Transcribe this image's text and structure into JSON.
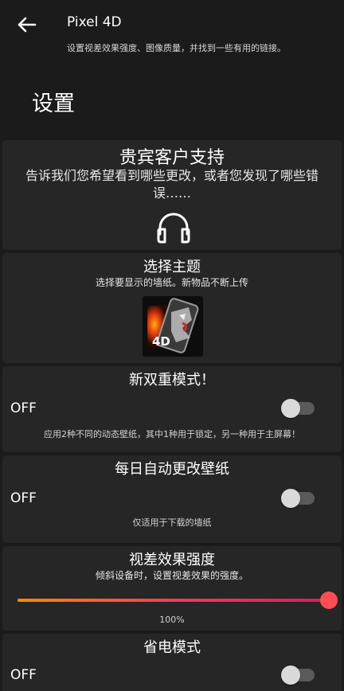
{
  "header": {
    "back_icon": "arrow-left-icon",
    "app_title": "Pixel 4D",
    "subtitle": "设置视差效果强度、图像质量，并找到一些有用的链接。"
  },
  "page_title": "设置",
  "cards": {
    "vip_support": {
      "title": "贵宾客户支持",
      "description": "告诉我们您希望看到哪些更改，或者您发现了哪些错误……",
      "icon": "headset-icon"
    },
    "theme": {
      "title": "选择主题",
      "description": "选择要显示的墙纸。新物品不断上传",
      "thumbnail_label": "4D"
    },
    "dual_mode": {
      "title": "新双重模式！",
      "state_label": "OFF",
      "enabled": false,
      "note": "应用2种不同的动态壁纸，其中1种用于锁定，另一种用于主屏幕！"
    },
    "daily_change": {
      "title": "每日自动更改壁纸",
      "state_label": "OFF",
      "enabled": false,
      "note": "仅适用于下载的墙纸"
    },
    "parallax": {
      "title": "视差效果强度",
      "description": "倾斜设备时，设置视差效果的强度。",
      "value": 1.0,
      "value_label": "100%"
    },
    "power_saving": {
      "title": "省电模式",
      "state_label": "OFF",
      "enabled": false
    }
  },
  "colors": {
    "background": "#1b1b1b",
    "card": "#262626",
    "slider_start": "#ff8a00",
    "slider_end": "#d81b60",
    "slider_thumb": "#ff4d52"
  }
}
